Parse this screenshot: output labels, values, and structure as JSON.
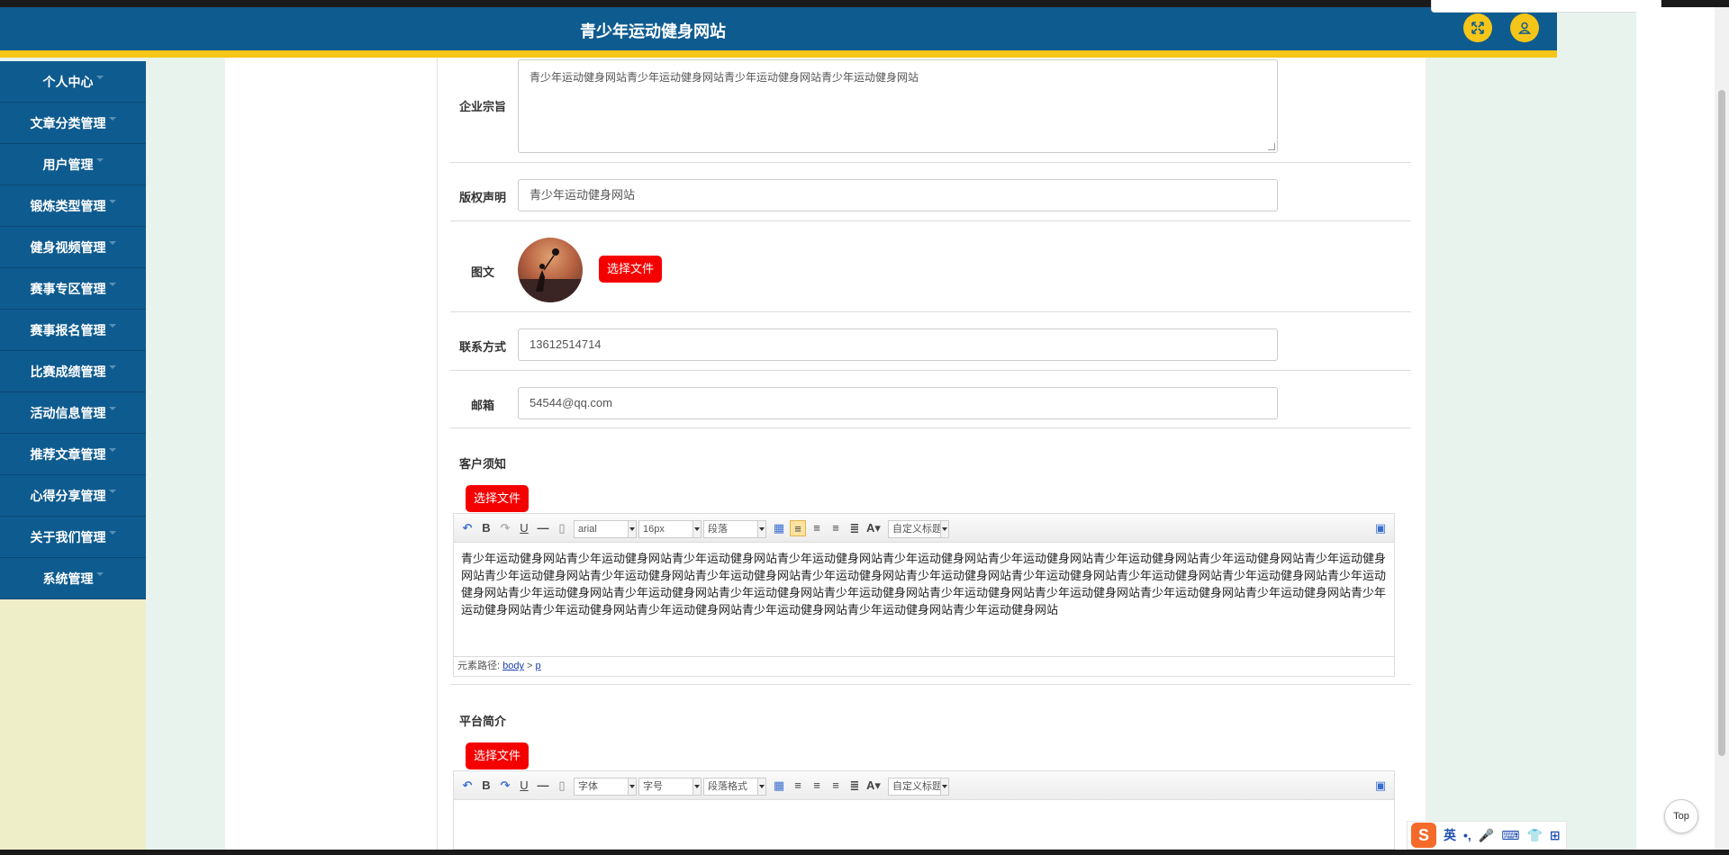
{
  "header": {
    "title": "青少年运动健身网站"
  },
  "sidebar": {
    "items": [
      {
        "label": "个人中心"
      },
      {
        "label": "文章分类管理"
      },
      {
        "label": "用户管理"
      },
      {
        "label": "锻炼类型管理"
      },
      {
        "label": "健身视频管理"
      },
      {
        "label": "赛事专区管理"
      },
      {
        "label": "赛事报名管理"
      },
      {
        "label": "比赛成绩管理"
      },
      {
        "label": "活动信息管理"
      },
      {
        "label": "推荐文章管理"
      },
      {
        "label": "心得分享管理"
      },
      {
        "label": "关于我们管理"
      },
      {
        "label": "系统管理"
      }
    ]
  },
  "form": {
    "mission": {
      "label": "企业宗旨",
      "value": "青少年运动健身网站青少年运动健身网站青少年运动健身网站青少年运动健身网站"
    },
    "copyright": {
      "label": "版权声明",
      "value": "青少年运动健身网站"
    },
    "image": {
      "label": "图文",
      "button": "选择文件"
    },
    "contact": {
      "label": "联系方式",
      "value": "13612514714"
    },
    "email": {
      "label": "邮箱",
      "value": "54544@qq.com"
    },
    "notice": {
      "label": "客户须知",
      "button": "选择文件",
      "font": "arial",
      "size": "16px",
      "format": "段落",
      "custom_title": "自定义标题",
      "body": "青少年运动健身网站青少年运动健身网站青少年运动健身网站青少年运动健身网站青少年运动健身网站青少年运动健身网站青少年运动健身网站青少年运动健身网站青少年运动健身网站青少年运动健身网站青少年运动健身网站青少年运动健身网站青少年运动健身网站青少年运动健身网站青少年运动健身网站青少年运动健身网站青少年运动健身网站青少年运动健身网站青少年运动健身网站青少年运动健身网站青少年运动健身网站青少年运动健身网站青少年运动健身网站青少年运动健身网站青少年运动健身网站青少年运动健身网站青少年运动健身网站青少年运动健身网站青少年运动健身网站青少年运动健身网站青少年运动健身网站青少年运动健身网站",
      "path_label": "元素路径:",
      "path_body": "body",
      "path_sep": " > ",
      "path_p": "p"
    },
    "intro": {
      "label": "平台简介",
      "button": "选择文件",
      "font": "字体",
      "size": "字号",
      "format": "段落格式",
      "custom_title": "自定义标题"
    }
  },
  "ime": {
    "logo": "S",
    "lang": "英",
    "punct": "•,",
    "mic": "🎤",
    "keyboard": "⌨",
    "skin": "👕",
    "apps": "⊞"
  },
  "top_button": "Top",
  "colors": {
    "header": "#0e5b8f",
    "stripe": "#f5c518",
    "button_red": "#f50000"
  }
}
